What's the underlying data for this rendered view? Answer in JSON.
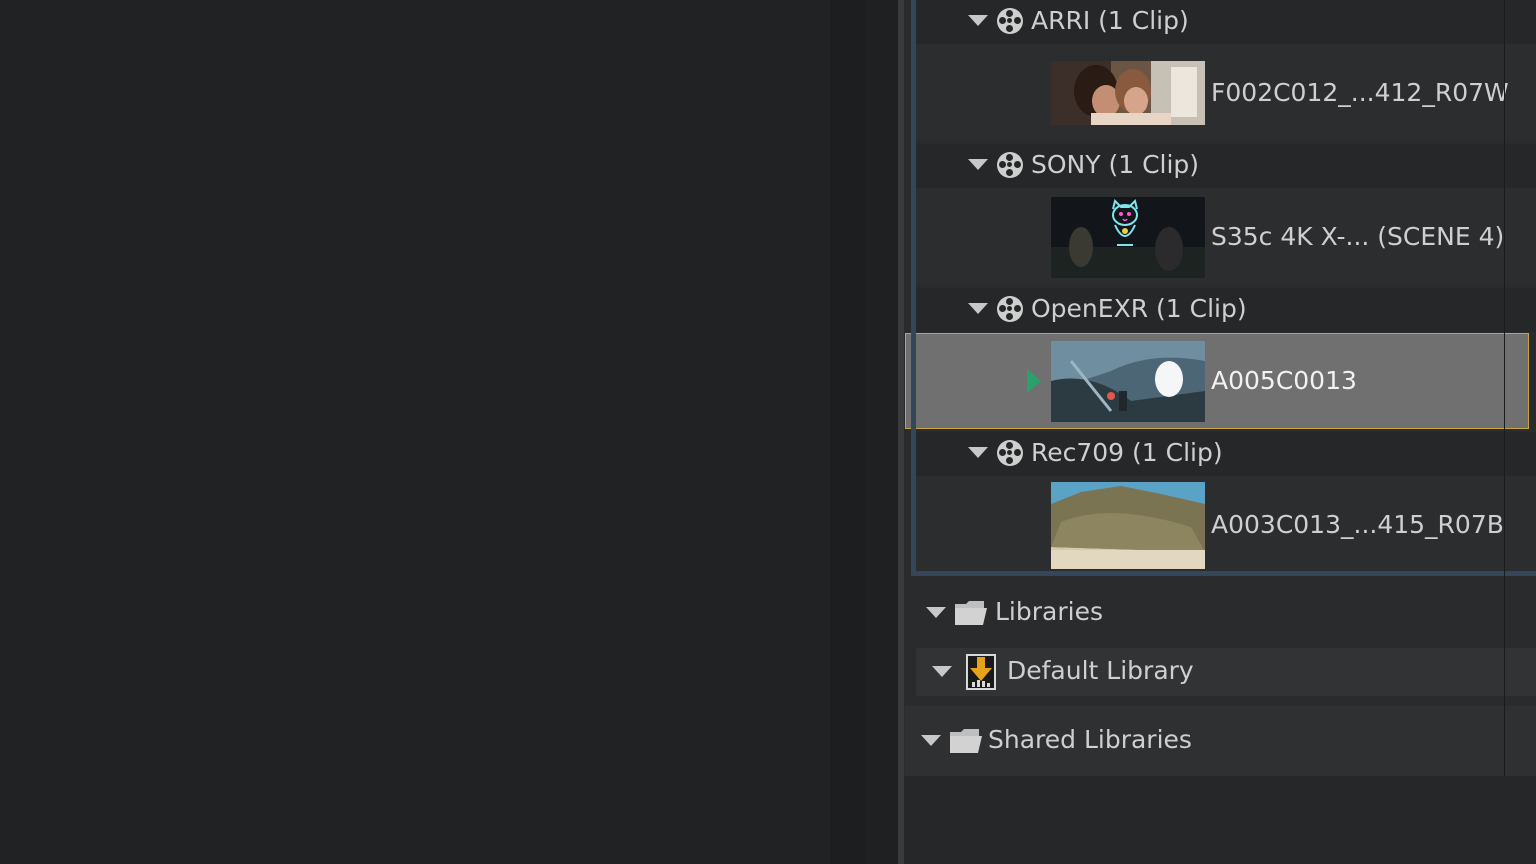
{
  "media_pool": {
    "bins": [
      {
        "label": "ARRI (1 Clip)",
        "clip": "F002C012_...412_R07W",
        "selected": false
      },
      {
        "label": "SONY (1 Clip)",
        "clip": "S35c 4K X-... (SCENE 4)",
        "selected": false
      },
      {
        "label": "OpenEXR (1 Clip)",
        "clip": "A005C0013",
        "selected": true
      },
      {
        "label": "Rec709 (1 Clip)",
        "clip": "A003C013_...415_R07B",
        "selected": false
      }
    ],
    "libraries": {
      "label": "Libraries",
      "default_library": "Default Library",
      "shared_libraries": "Shared Libraries"
    }
  },
  "colors": {
    "selection_border": "#c9a43a",
    "play_indicator": "#2aa06a",
    "library_icon": "#e8a21a"
  },
  "icons": [
    "disclosure-triangle-icon",
    "film-reel-icon",
    "folder-icon",
    "library-download-icon",
    "play-indicator-icon"
  ]
}
